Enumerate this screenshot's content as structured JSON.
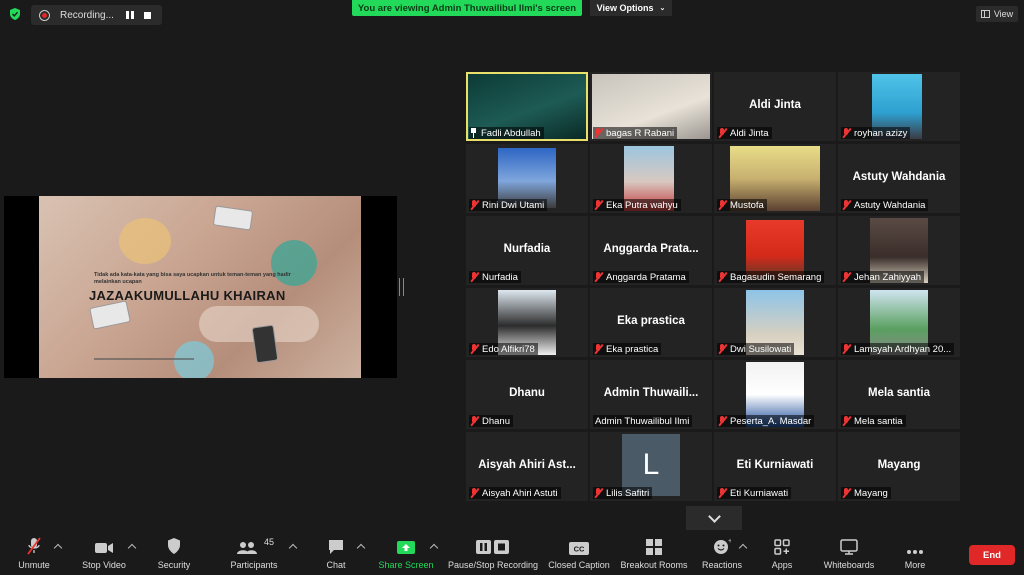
{
  "recording": {
    "label": "Recording..."
  },
  "banner": {
    "text": "You are viewing Admin Thuwailibul Ilmi's screen"
  },
  "view_options": {
    "label": "View Options"
  },
  "view_button": {
    "label": "View"
  },
  "slide": {
    "small_text": "Tidak ada kata-kata yang bisa saya ucapkan untuk teman-teman yang hadir melainkan ucapan",
    "title": "JAZAAKUMULLAHU KHAIRAN"
  },
  "participants": [
    {
      "label": "Fadli Abdullah",
      "video": true,
      "pinned": true,
      "active": true
    },
    {
      "label": "bagas R Rabani",
      "video": true
    },
    {
      "center": "Aldi Jinta",
      "label": "Aldi Jinta"
    },
    {
      "label": "royhan azizy",
      "video": true
    },
    {
      "label": "Rini Dwi Utami",
      "video": true
    },
    {
      "label": "Eka Putra wahyu",
      "video": true
    },
    {
      "label": "Mustofa",
      "video": true
    },
    {
      "center": "Astuty Wahdania",
      "label": "Astuty Wahdania"
    },
    {
      "center": "Nurfadia",
      "label": "Nurfadia"
    },
    {
      "center": "Anggarda  Prata...",
      "label": "Anggarda Pratama"
    },
    {
      "label": "Bagasudin Semarang",
      "video": true
    },
    {
      "label": "Jehan Zahiyyah",
      "video": true
    },
    {
      "label": "Edo Alfikri78",
      "video": true
    },
    {
      "center": "Eka prastica",
      "label": "Eka prastica"
    },
    {
      "label": "Dwi Susilowati",
      "video": true
    },
    {
      "label": "Lamsyah Ardhyan 20...",
      "video": true
    },
    {
      "center": "Dhanu",
      "label": "Dhanu"
    },
    {
      "center": "Admin  Thuwaili...",
      "label": "Admin Thuwailibul Ilmi",
      "unmuted": true
    },
    {
      "label": "Peserta_A. Masdar",
      "video": true
    },
    {
      "center": "Mela santia",
      "label": "Mela santia"
    },
    {
      "center": "Aisyah Ahiri Ast...",
      "label": "Aisyah Ahiri Astuti"
    },
    {
      "label": "Lilis Safitri",
      "avatar_letter": "L"
    },
    {
      "center": "Eti Kurniawati",
      "label": "Eti Kurniawati"
    },
    {
      "center": "Mayang",
      "label": "Mayang"
    }
  ],
  "toolbar": {
    "unmute": "Unmute",
    "stop_video": "Stop Video",
    "security": "Security",
    "participants": "Participants",
    "participants_count": "45",
    "chat": "Chat",
    "share_screen": "Share Screen",
    "pause_stop_recording": "Pause/Stop Recording",
    "closed_caption": "Closed Caption",
    "breakout_rooms": "Breakout Rooms",
    "reactions": "Reactions",
    "apps": "Apps",
    "whiteboards": "Whiteboards",
    "more": "More",
    "end": "End"
  },
  "colors": {
    "banner_green": "#23d959",
    "end_red": "#e02828",
    "active_speaker": "#e8e06a",
    "muted_red": "#e33333"
  }
}
